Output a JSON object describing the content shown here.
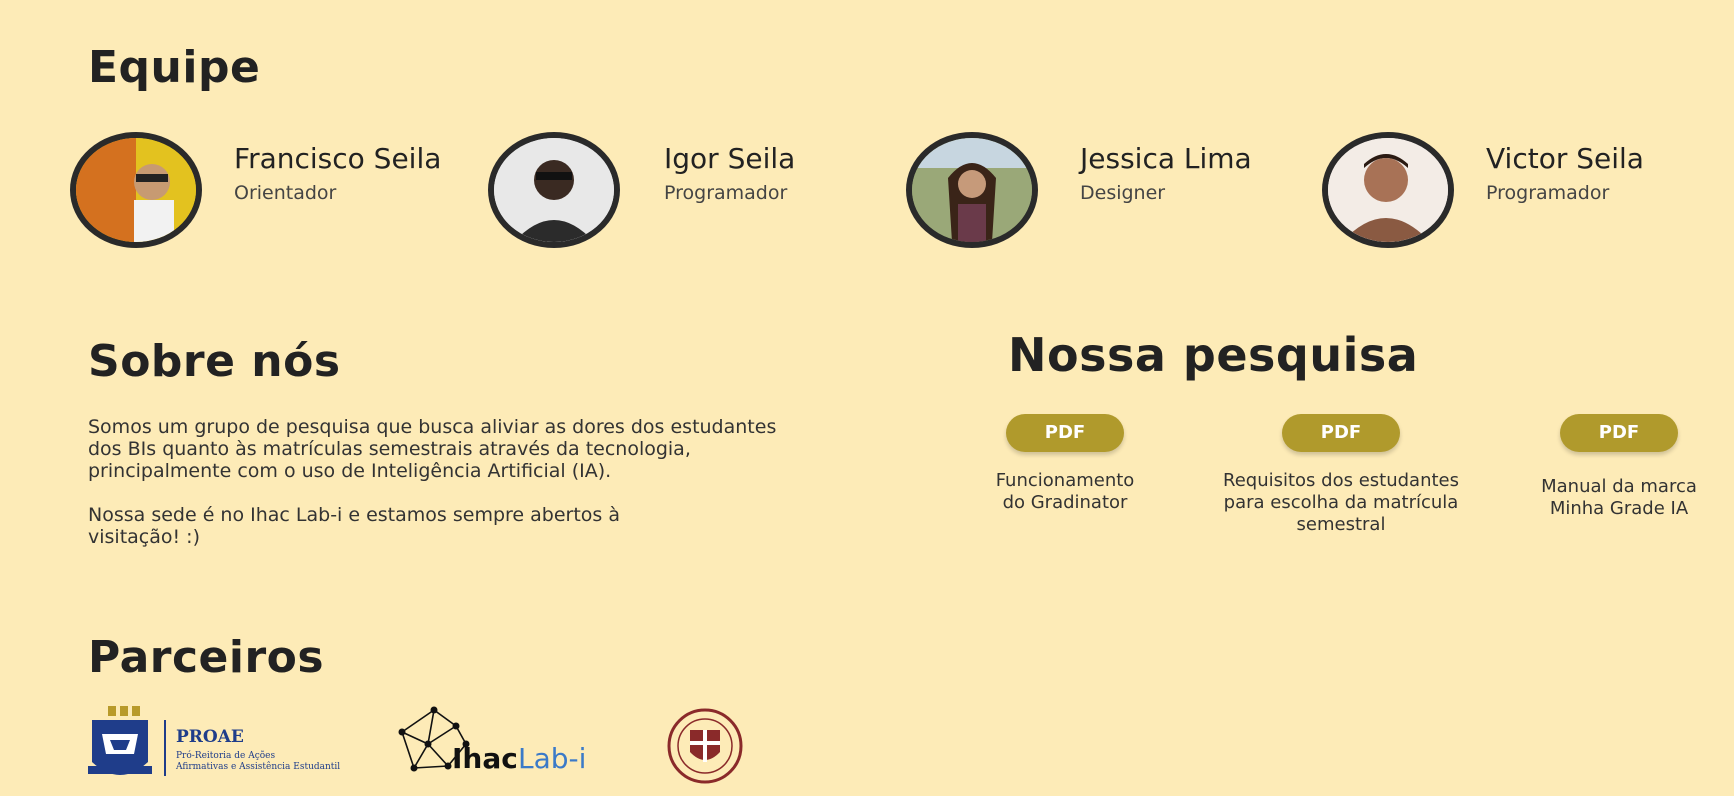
{
  "equipe": {
    "title": "Equipe",
    "members": [
      {
        "name": "Francisco Seila",
        "role": "Orientador",
        "avatar_icon": "person-photo-icon"
      },
      {
        "name": "Igor Seila",
        "role": "Programador",
        "avatar_icon": "person-photo-icon"
      },
      {
        "name": "Jessica Lima",
        "role": "Designer",
        "avatar_icon": "person-photo-icon"
      },
      {
        "name": "Victor  Seila",
        "role": "Programador",
        "avatar_icon": "person-photo-icon"
      }
    ]
  },
  "sobre": {
    "title": "Sobre nós",
    "paragraph1": "Somos um grupo de pesquisa que busca aliviar as dores dos estudantes dos BIs quanto às matrículas semestrais através da tecnologia, principalmente com o uso de Inteligência Artificial (IA).",
    "paragraph2": "Nossa sede é no Ihac Lab-i  e estamos sempre abertos à visitação! :)"
  },
  "pesquisa": {
    "title": "Nossa pesquisa",
    "items": [
      {
        "button": "PDF",
        "caption": "Funcionamento do Gradinator"
      },
      {
        "button": "PDF",
        "caption": "Requisitos dos estudantes para escolha da matrícula semestral"
      },
      {
        "button": "PDF",
        "caption": "Manual da marca Minha Grade IA"
      }
    ]
  },
  "parceiros": {
    "title": "Parceiros",
    "proae": {
      "name": "PROAE",
      "subtitle_line1": "Pró-Reitoria de Ações",
      "subtitle_line2": "Afirmativas e Assistência Estudantil"
    },
    "ihac": {
      "part1": "Ihac",
      "part2": "Lab-i"
    }
  },
  "colors": {
    "background": "#fdebb7",
    "text": "#222222",
    "pdf_button": "#b09a2c",
    "proae_blue": "#1f3d8a",
    "ihac_blue": "#3b7ac8",
    "seal_red": "#8a2a2a"
  }
}
